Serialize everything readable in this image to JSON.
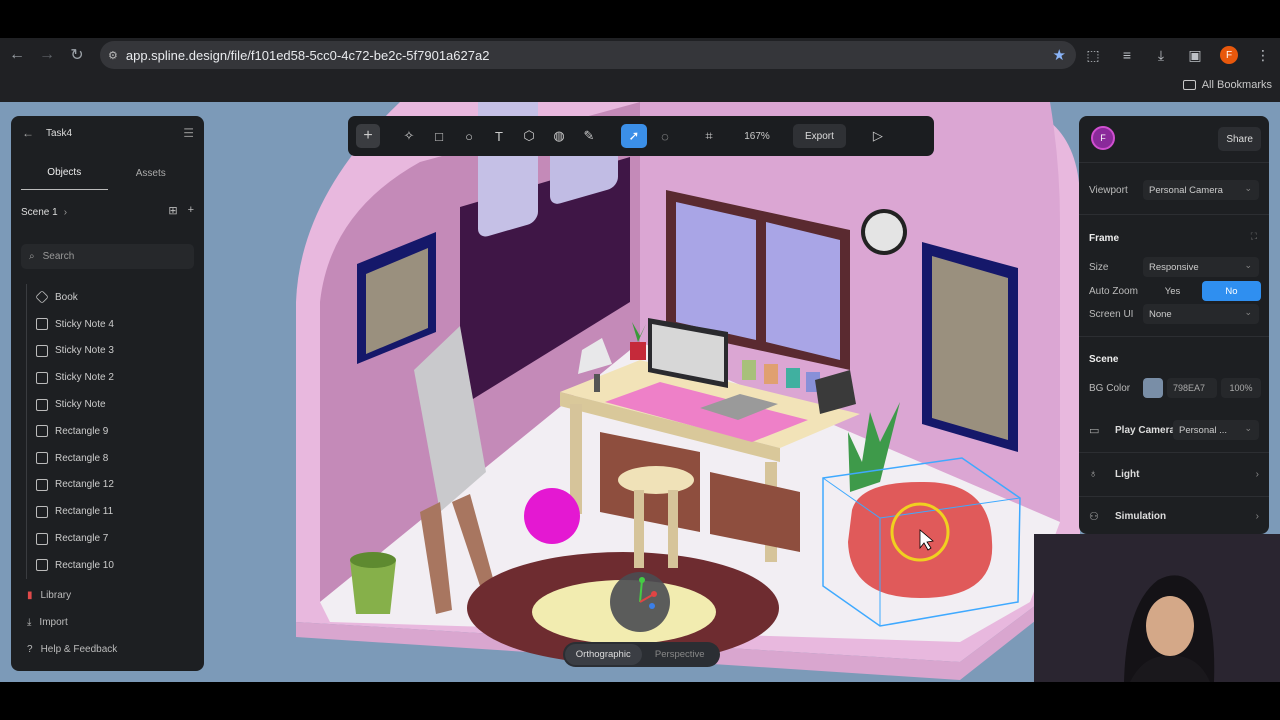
{
  "browser": {
    "url": "app.spline.design/file/f101ed58-5cc0-4c72-be2c-5f7901a627a2",
    "avatar_letter": "F",
    "bookmarks_label": "All Bookmarks"
  },
  "left_panel": {
    "file_name": "Task4",
    "tabs": [
      "Objects",
      "Assets"
    ],
    "scene_label": "Scene 1",
    "search_placeholder": "Search",
    "objects": [
      "Book",
      "Sticky Note 4",
      "Sticky Note 3",
      "Sticky Note 2",
      "Sticky Note",
      "Rectangle 9",
      "Rectangle 8",
      "Rectangle 12",
      "Rectangle 11",
      "Rectangle 7",
      "Rectangle 10"
    ],
    "library_label": "Library",
    "import_label": "Import",
    "help_label": "Help & Feedback"
  },
  "toolbar": {
    "zoom": "167%",
    "export_label": "Export"
  },
  "right_panel": {
    "avatar_letter": "F",
    "share_label": "Share",
    "viewport_label": "Viewport",
    "viewport_value": "Personal Camera",
    "frame_heading": "Frame",
    "size_label": "Size",
    "size_value": "Responsive",
    "auto_zoom_label": "Auto Zoom",
    "auto_zoom_yes": "Yes",
    "auto_zoom_no": "No",
    "screen_ui_label": "Screen UI",
    "screen_ui_value": "None",
    "scene_heading": "Scene",
    "bg_color_label": "BG Color",
    "bg_color_hex": "798EA7",
    "bg_opacity": "100%",
    "play_camera_label": "Play Camera",
    "play_camera_value": "Personal ...",
    "light_label": "Light",
    "simulation_label": "Simulation"
  },
  "view_mode": {
    "options": [
      "Orthographic",
      "Perspective"
    ],
    "active": "Orthographic"
  },
  "colors": {
    "accent": "#2f8ff0",
    "viewport_bg": "#7c9ab8",
    "room_pink": "#d7a3cf",
    "bean_bag": "#e05a5a"
  }
}
